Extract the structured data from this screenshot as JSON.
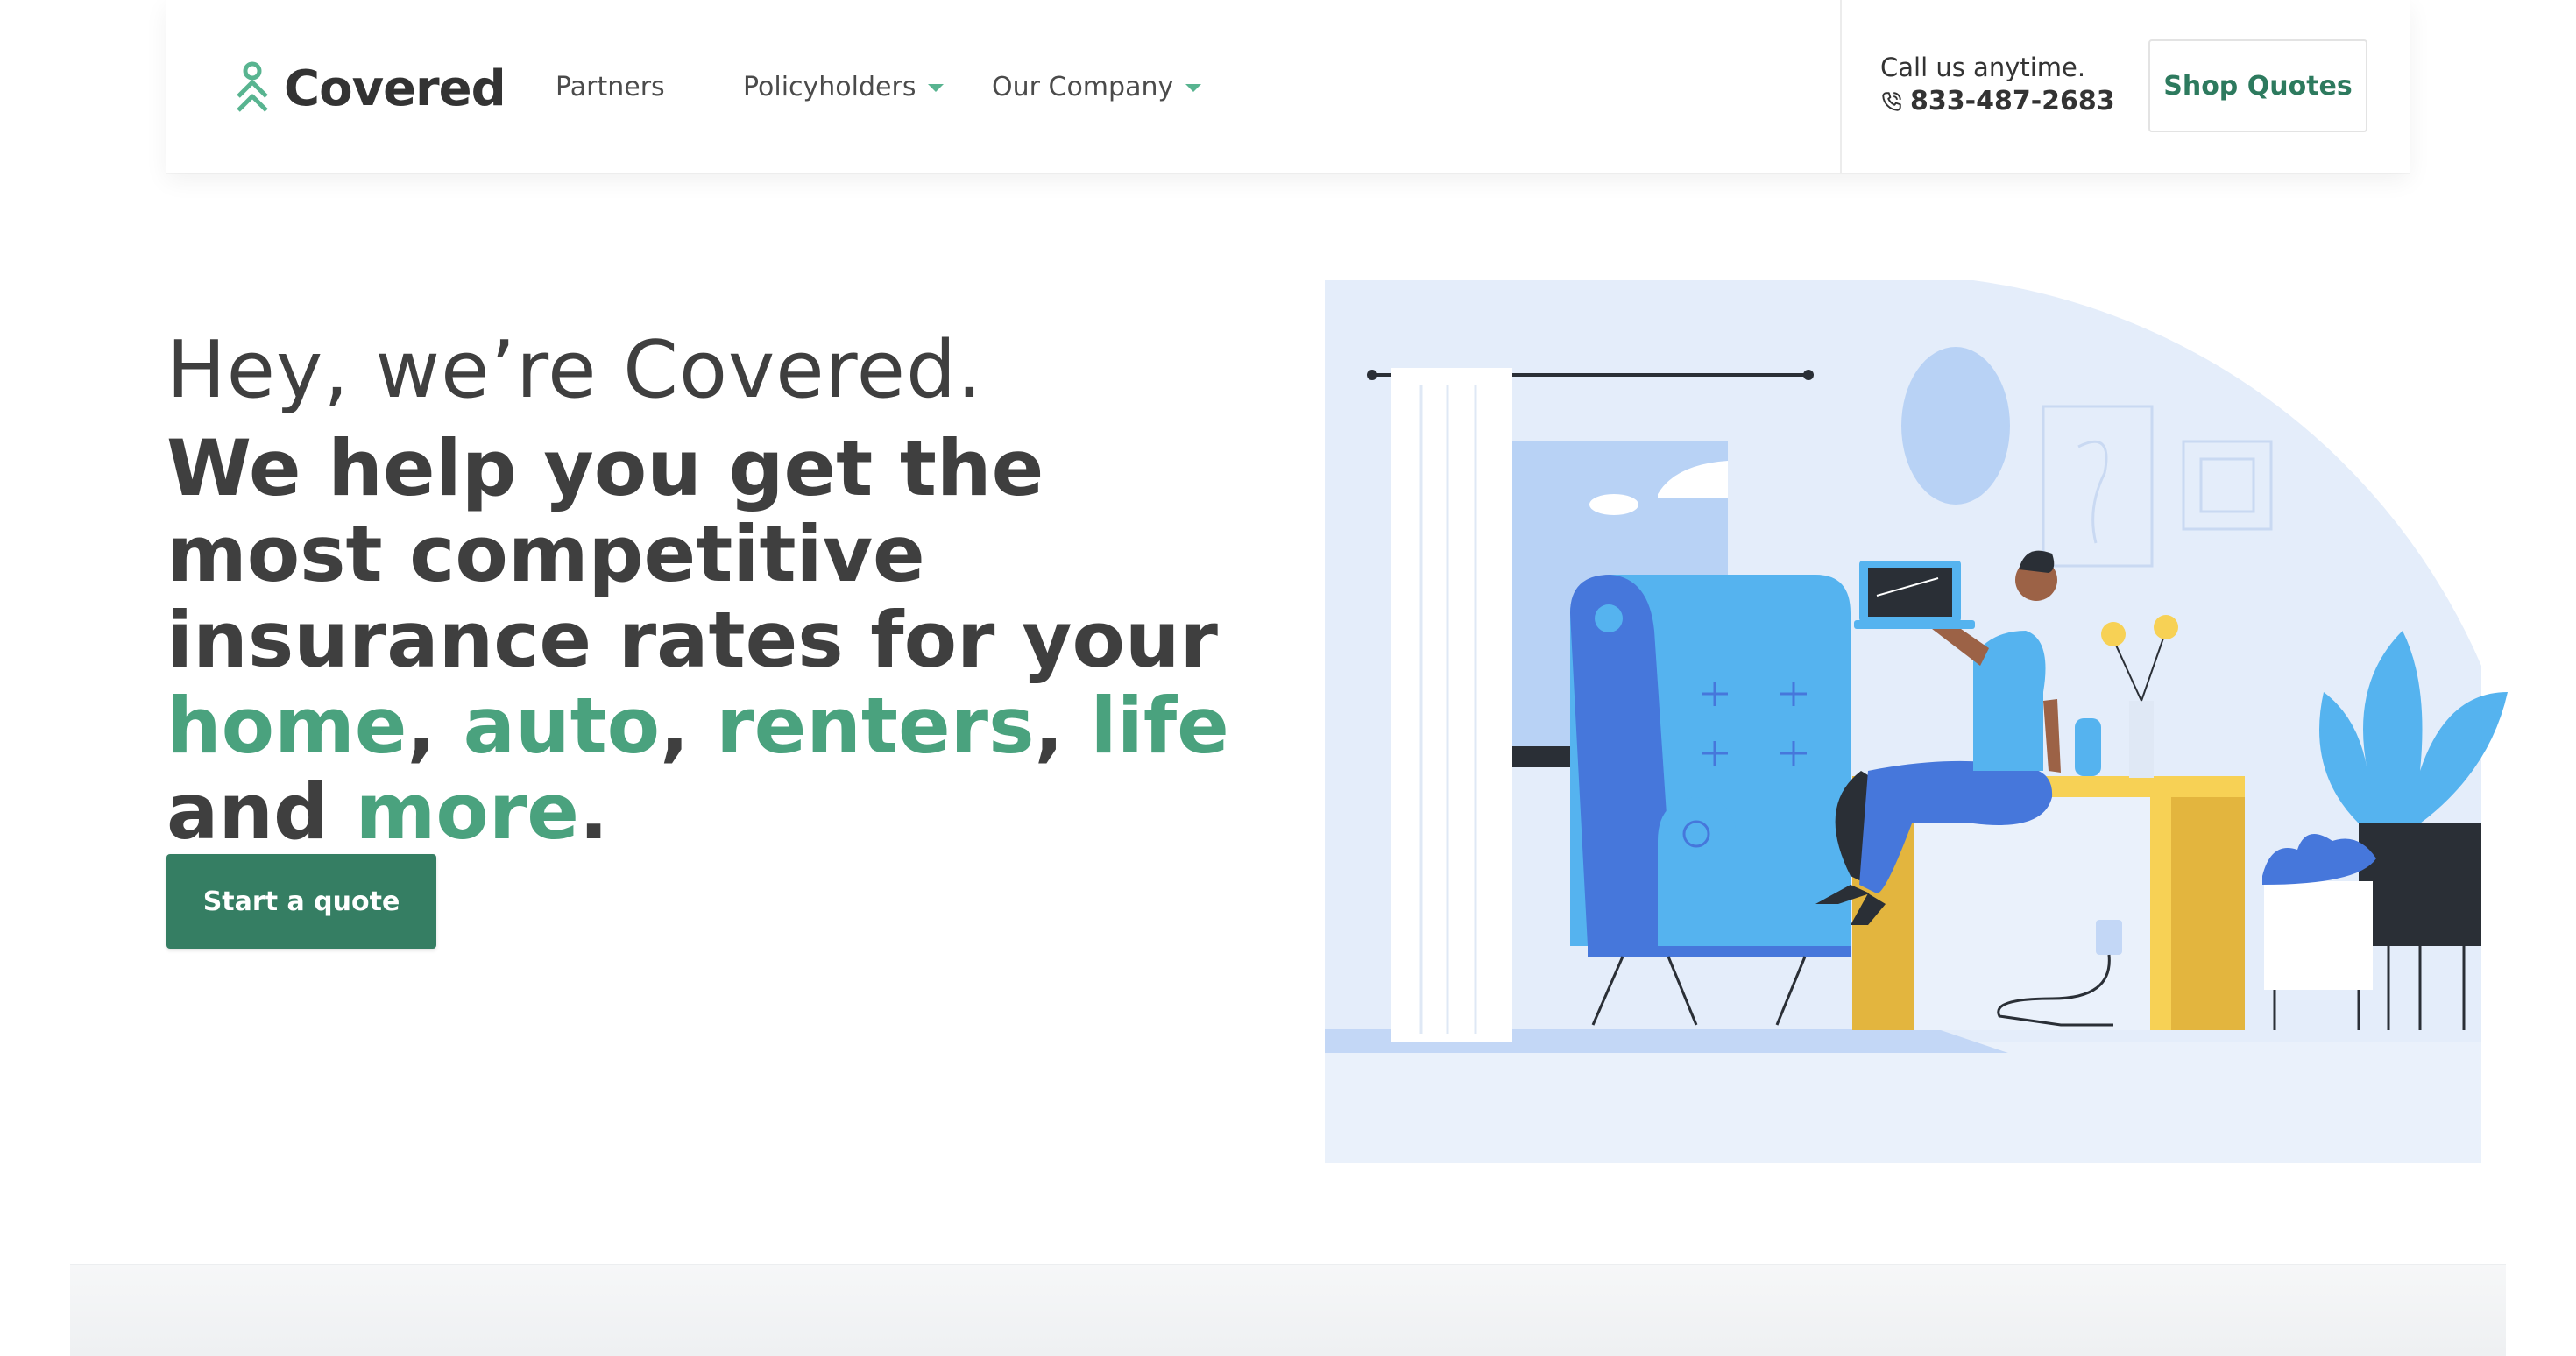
{
  "brand": {
    "name": "Covered",
    "accent": "#58b490",
    "dark_green": "#357e63",
    "text": "#3f3f3f"
  },
  "nav": {
    "items": [
      {
        "label": "Partners",
        "has_dropdown": false
      },
      {
        "label": "Policyholders",
        "has_dropdown": true
      },
      {
        "label": "Our Company",
        "has_dropdown": true
      }
    ]
  },
  "contact": {
    "label": "Call us anytime.",
    "phone": "833-487-2683",
    "icon": "phone-icon"
  },
  "header_cta": {
    "label": "Shop Quotes"
  },
  "hero": {
    "subtitle": "Hey, we’re Covered.",
    "title_parts": {
      "p1": "We help you get the most competitive insurance rates for your ",
      "home": "home",
      "sep1": ", ",
      "auto": "auto",
      "sep2": ", ",
      "renters": "renters",
      "sep3": ", ",
      "life": "life",
      "and": " and ",
      "more": "more",
      "end": "."
    },
    "cta_label": "Start a quote"
  }
}
